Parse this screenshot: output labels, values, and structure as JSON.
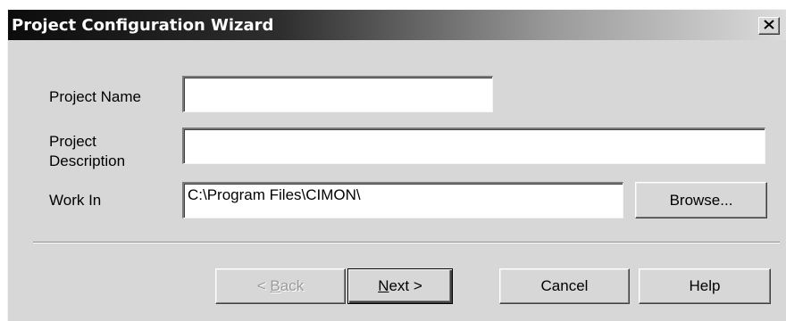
{
  "window": {
    "title": "Project Configuration Wizard",
    "close_glyph": "X"
  },
  "form": {
    "project_name": {
      "label": "Project Name",
      "value": ""
    },
    "project_description": {
      "label_line1": "Project",
      "label_line2": "Description",
      "value": ""
    },
    "work_in": {
      "label": "Work In",
      "value": "C:\\Program Files\\CIMON\\"
    }
  },
  "buttons": {
    "browse": "Browse...",
    "back_underlined": "B",
    "back_prefix": "< ",
    "back_rest": "ack",
    "next_underlined": "N",
    "next_rest": "ext >",
    "cancel": "Cancel",
    "help": "Help"
  },
  "colors": {
    "dialog_bg": "#d7d7d7",
    "titlebar_start": "#0c0c0c",
    "titlebar_end": "#dcdcdc",
    "disabled_text": "#9a9a9a"
  },
  "icons": {
    "close": "close-icon"
  }
}
